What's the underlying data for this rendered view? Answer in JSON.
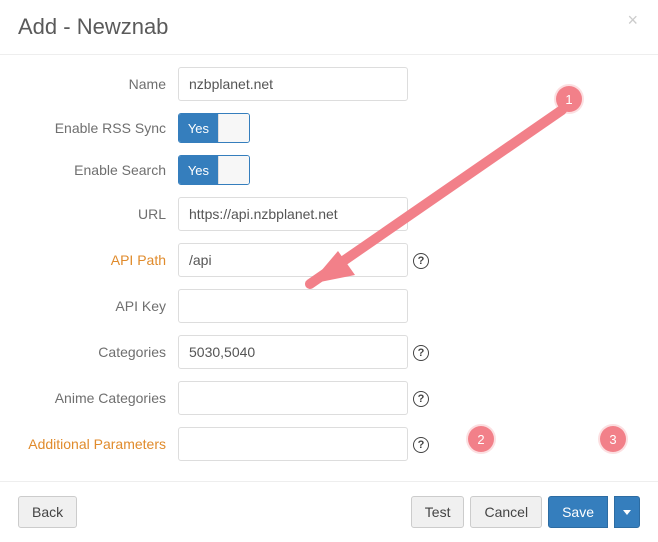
{
  "modal": {
    "title": "Add - Newznab"
  },
  "fields": {
    "name": {
      "label": "Name",
      "value": "nzbplanet.net"
    },
    "rss": {
      "label": "Enable RSS Sync",
      "toggle": "Yes"
    },
    "search": {
      "label": "Enable Search",
      "toggle": "Yes"
    },
    "url": {
      "label": "URL",
      "value": "https://api.nzbplanet.net"
    },
    "apipath": {
      "label": "API Path",
      "value": "/api"
    },
    "apikey": {
      "label": "API Key",
      "value": ""
    },
    "categories": {
      "label": "Categories",
      "value": "5030,5040"
    },
    "anime": {
      "label": "Anime Categories",
      "value": ""
    },
    "additional": {
      "label": "Additional Parameters",
      "value": ""
    }
  },
  "footer": {
    "back": "Back",
    "test": "Test",
    "cancel": "Cancel",
    "save": "Save"
  },
  "annotations": {
    "c1": "1",
    "c2": "2",
    "c3": "3"
  }
}
